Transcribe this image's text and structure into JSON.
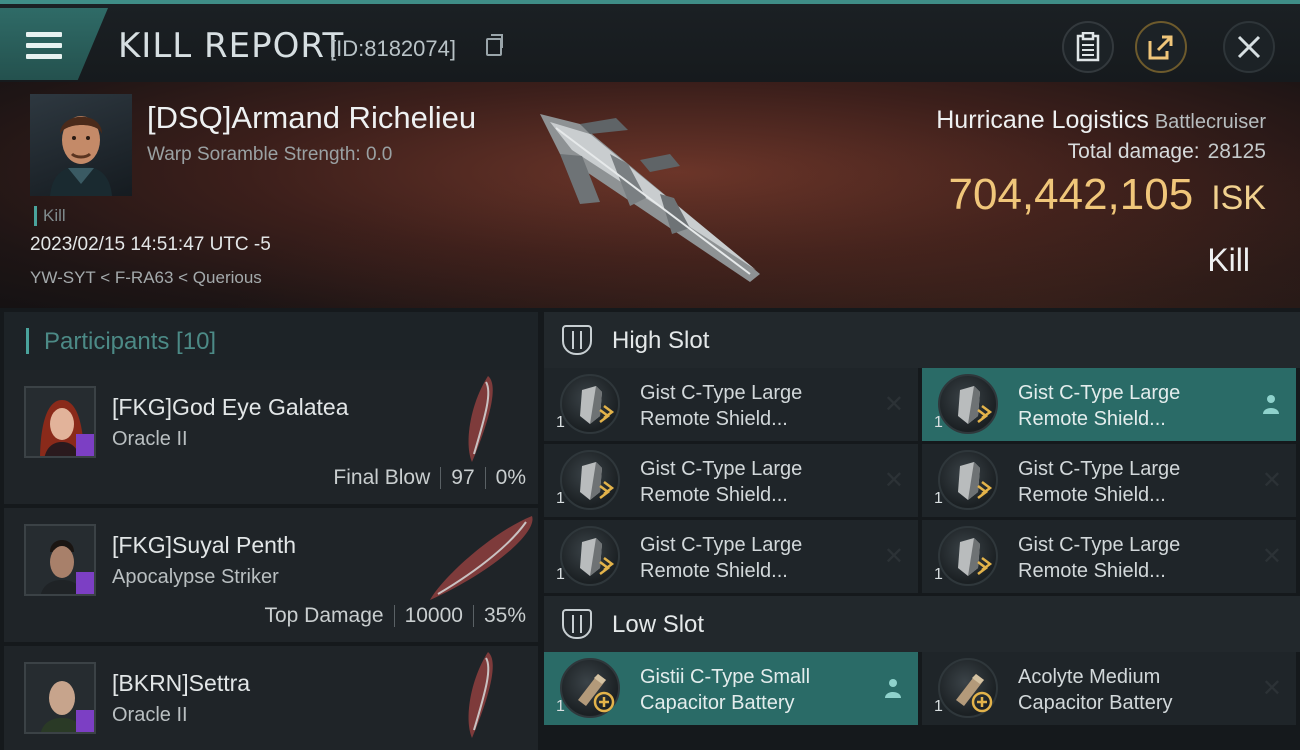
{
  "header": {
    "title": "KILL REPORT",
    "report_id": "[ID:8182074]"
  },
  "victim": {
    "name": "[DSQ]Armand Richelieu",
    "scramble": "Warp Soramble Strength: 0.0",
    "badge": "Kill",
    "datetime": "2023/02/15 14:51:47 UTC -5",
    "location": "YW-SYT < F-RA63 < Querious"
  },
  "ship": {
    "name": "Hurricane Logistics",
    "class": "Battlecruiser",
    "total_damage_label": "Total damage:",
    "total_damage": "28125",
    "value": "704,442,105",
    "currency": "ISK",
    "result": "Kill"
  },
  "participants": {
    "title": "Participants [10]",
    "rows": [
      {
        "name": "[FKG]God Eye Galatea",
        "ship": "Oracle II",
        "label": "Final Blow",
        "damage": "97",
        "percent": "0%"
      },
      {
        "name": "[FKG]Suyal Penth",
        "ship": "Apocalypse Striker",
        "label": "Top Damage",
        "damage": "10000",
        "percent": "35%"
      },
      {
        "name": "[BKRN]Settra",
        "ship": "Oracle II"
      }
    ]
  },
  "high_slot": {
    "title": "High Slot",
    "modules": [
      {
        "qty": "1",
        "line1": "Gist C-Type Large",
        "line2": "Remote Shield...",
        "status": "destroyed"
      },
      {
        "qty": "1",
        "line1": "Gist C-Type Large",
        "line2": "Remote Shield...",
        "status": "dropped"
      },
      {
        "qty": "1",
        "line1": "Gist C-Type Large",
        "line2": "Remote Shield...",
        "status": "destroyed"
      },
      {
        "qty": "1",
        "line1": "Gist C-Type Large",
        "line2": "Remote Shield...",
        "status": "destroyed"
      },
      {
        "qty": "1",
        "line1": "Gist C-Type Large",
        "line2": "Remote Shield...",
        "status": "destroyed"
      },
      {
        "qty": "1",
        "line1": "Gist C-Type Large",
        "line2": "Remote Shield...",
        "status": "destroyed"
      }
    ]
  },
  "low_slot": {
    "title": "Low Slot",
    "modules": [
      {
        "qty": "1",
        "line1": "Gistii C-Type Small",
        "line2": "Capacitor Battery",
        "status": "dropped"
      },
      {
        "qty": "1",
        "line1": "Acolyte Medium",
        "line2": "Capacitor Battery",
        "status": "destroyed"
      }
    ]
  },
  "colors": {
    "accent": "#4aa39c",
    "isk": "#f0c67a",
    "dropped_bg": "#2a6b67",
    "destroyed_bg": "#1f2529",
    "role_tag": "#7c3fc4"
  },
  "icons": {
    "menu": "hamburger-icon",
    "copy": "copy-icon",
    "clipboard": "clipboard-icon",
    "share": "share-icon",
    "close": "close-icon",
    "slot": "slot-shield-icon",
    "destroyed": "x-mark-icon",
    "dropped": "person-icon"
  }
}
